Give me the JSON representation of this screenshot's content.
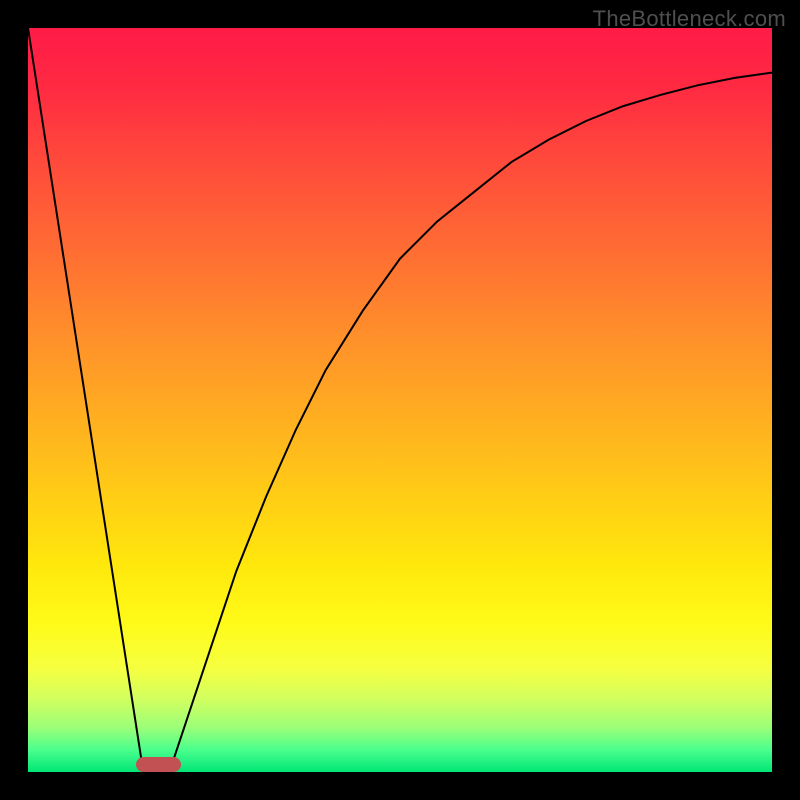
{
  "watermark": "TheBottleneck.com",
  "colors": {
    "frame": "#000000",
    "marker": "#c25154",
    "curve": "#000000",
    "gradient_top": "#ff1b47",
    "gradient_bottom": "#00e676"
  },
  "chart_data": {
    "type": "line",
    "title": "",
    "xlabel": "",
    "ylabel": "",
    "xlim": [
      0,
      100
    ],
    "ylim": [
      0,
      100
    ],
    "grid": false,
    "legend": false,
    "marker": {
      "x_center": 17.5,
      "width": 6,
      "y": 0,
      "height": 2
    },
    "series": [
      {
        "name": "left-line",
        "x": [
          0,
          15.5
        ],
        "y": [
          100,
          0
        ]
      },
      {
        "name": "right-curve",
        "x": [
          19,
          22,
          25,
          28,
          32,
          36,
          40,
          45,
          50,
          55,
          60,
          65,
          70,
          75,
          80,
          85,
          90,
          95,
          100
        ],
        "y": [
          0,
          9,
          18,
          27,
          37,
          46,
          54,
          62,
          69,
          74,
          78,
          82,
          85,
          87.5,
          89.5,
          91,
          92.3,
          93.3,
          94
        ]
      }
    ]
  }
}
